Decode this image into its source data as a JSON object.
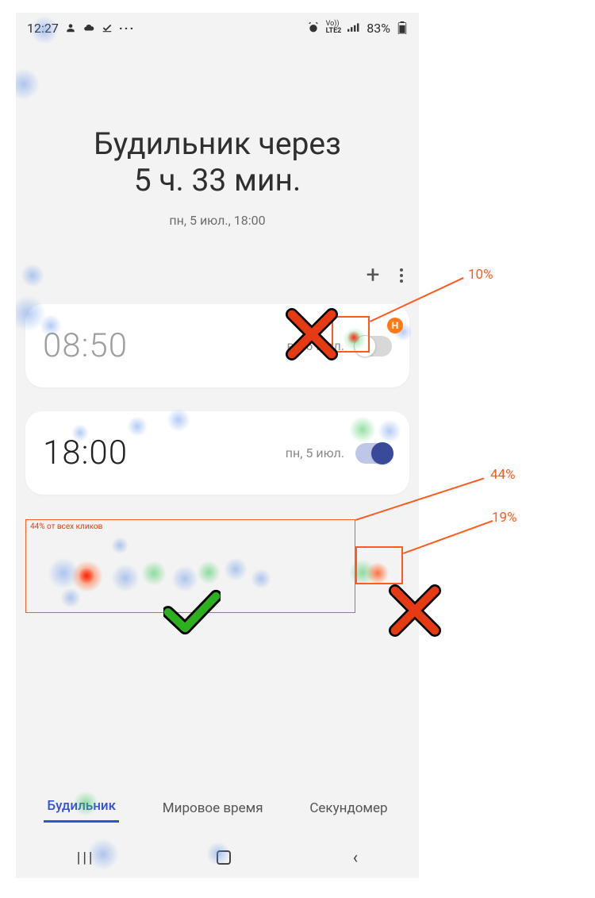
{
  "statusbar": {
    "time": "12:27",
    "lte_label": "LTE2",
    "vo_label": "Vo))",
    "battery": "83%"
  },
  "header": {
    "line1": "Будильник через",
    "line2": "5 ч. 33 мин.",
    "subtitle": "пн, 5 июл., 18:00"
  },
  "toolbar": {
    "add_label": "+"
  },
  "alarms": [
    {
      "time": "08:50",
      "date": "вт, 6 июл.",
      "enabled": false
    },
    {
      "time": "18:00",
      "date": "пн, 5 июл.",
      "enabled": true
    }
  ],
  "tabs": {
    "items": [
      "Будильник",
      "Мировое время",
      "Секундомер"
    ],
    "selected_index": 0
  },
  "annotations": {
    "percent_add": "10%",
    "percent_row": "44%",
    "percent_toggle": "19%",
    "row_caption": "44% от всех кликов",
    "badge_H": "H"
  }
}
